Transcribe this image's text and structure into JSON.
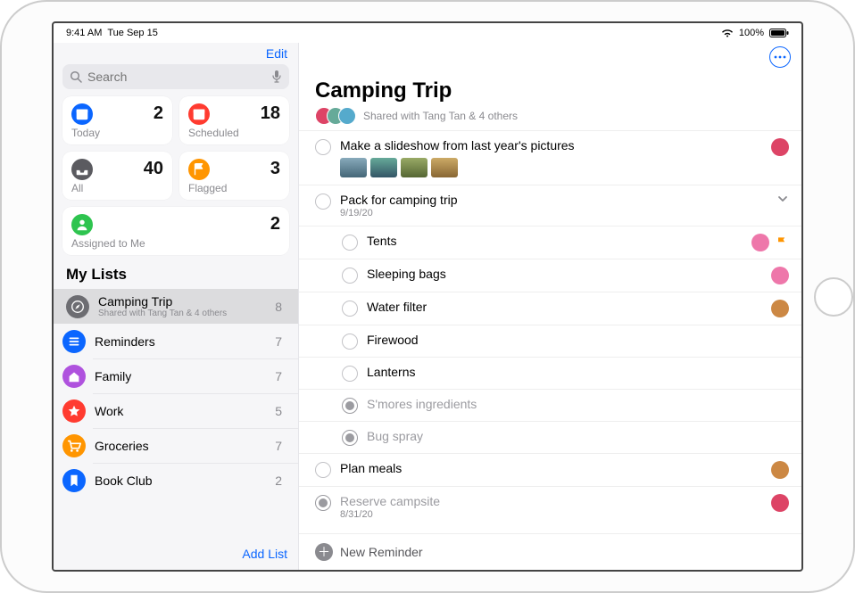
{
  "statusbar": {
    "time": "9:41 AM",
    "date": "Tue Sep 15",
    "battery": "100%"
  },
  "sidebar": {
    "edit": "Edit",
    "search_placeholder": "Search",
    "cards": [
      {
        "id": "today",
        "label": "Today",
        "count": 2,
        "color": "#0b66ff",
        "icon": "calendar"
      },
      {
        "id": "scheduled",
        "label": "Scheduled",
        "count": 18,
        "color": "#ff3b30",
        "icon": "calendar"
      },
      {
        "id": "all",
        "label": "All",
        "count": 40,
        "color": "#5b5b60",
        "icon": "tray"
      },
      {
        "id": "flagged",
        "label": "Flagged",
        "count": 3,
        "color": "#ff9500",
        "icon": "flag"
      },
      {
        "id": "assigned",
        "label": "Assigned to Me",
        "count": 2,
        "color": "#2ec44f",
        "icon": "person",
        "full": true
      }
    ],
    "mylists_header": "My Lists",
    "lists": [
      {
        "title": "Camping Trip",
        "subtitle": "Shared with Tang Tan & 4 others",
        "count": 8,
        "color": "#6d6d72",
        "icon": "compass",
        "selected": true
      },
      {
        "title": "Reminders",
        "subtitle": "",
        "count": 7,
        "color": "#0b66ff",
        "icon": "list"
      },
      {
        "title": "Family",
        "subtitle": "",
        "count": 7,
        "color": "#af52de",
        "icon": "house"
      },
      {
        "title": "Work",
        "subtitle": "",
        "count": 5,
        "color": "#ff3b30",
        "icon": "star"
      },
      {
        "title": "Groceries",
        "subtitle": "",
        "count": 7,
        "color": "#ff9500",
        "icon": "cart"
      },
      {
        "title": "Book Club",
        "subtitle": "",
        "count": 2,
        "color": "#0b66ff",
        "icon": "bookmark"
      }
    ],
    "add_list": "Add List"
  },
  "main": {
    "title": "Camping Trip",
    "shared_text": "Shared with Tang Tan & 4 others",
    "avatar_count": 3,
    "reminders": [
      {
        "title": "Make a slideshow from last year's pictures",
        "done": false,
        "thumbs": 4,
        "avatar": "#d46",
        "level": 0
      },
      {
        "title": "Pack for camping trip",
        "subtitle": "9/19/20",
        "done": false,
        "chevron": true,
        "level": 0
      },
      {
        "title": "Tents",
        "done": false,
        "avatar": "#e7a",
        "flag": true,
        "level": 1
      },
      {
        "title": "Sleeping bags",
        "done": false,
        "avatar": "#e7a",
        "level": 1
      },
      {
        "title": "Water filter",
        "done": false,
        "avatar": "#c84",
        "level": 1
      },
      {
        "title": "Firewood",
        "done": false,
        "level": 1
      },
      {
        "title": "Lanterns",
        "done": false,
        "level": 1
      },
      {
        "title": "S'mores ingredients",
        "done": true,
        "level": 1
      },
      {
        "title": "Bug spray",
        "done": true,
        "level": 1
      },
      {
        "title": "Plan meals",
        "done": false,
        "avatar": "#c84",
        "level": 0
      },
      {
        "title": "Reserve campsite",
        "subtitle": "8/31/20",
        "done": true,
        "avatar": "#d46",
        "level": 0
      }
    ],
    "new_reminder": "New Reminder"
  }
}
